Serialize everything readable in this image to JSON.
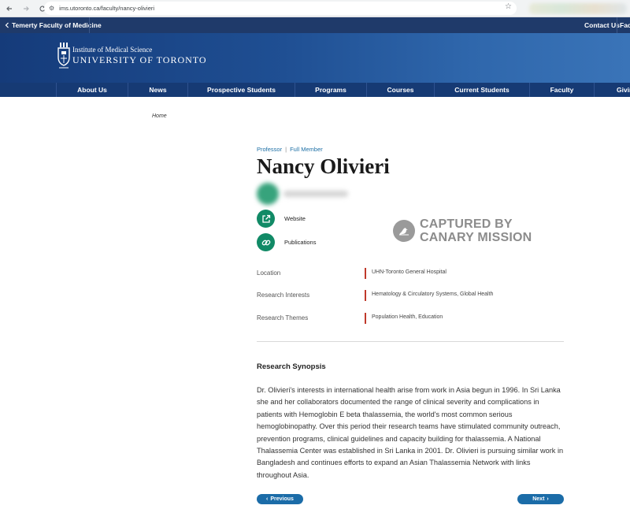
{
  "browser": {
    "url": "ims.utoronto.ca/faculty/nancy-olivieri"
  },
  "faculty_bar": {
    "back_link": "Temerty Faculty of Medicine",
    "contact": "Contact Us",
    "faculty_truncated": "Facu"
  },
  "banner": {
    "institute": "Institute of Medical Science",
    "university": "UNIVERSITY OF TORONTO"
  },
  "nav": {
    "items": [
      "About Us",
      "News",
      "Prospective Students",
      "Programs",
      "Courses",
      "Current Students",
      "Faculty",
      "Givin"
    ]
  },
  "breadcrumb": "Home",
  "profile": {
    "role_primary": "Professor",
    "role_secondary": "Full Member",
    "name": "Nancy Olivieri",
    "website_label": "Website",
    "publications_label": "Publications"
  },
  "watermark": {
    "line1": "CAPTURED BY",
    "line2": "CANARY MISSION"
  },
  "info": [
    {
      "label": "Location",
      "value": "UHN-Toronto General Hospital"
    },
    {
      "label": "Research Interests",
      "value": "Hematology & Circulatory Systems, Global Health"
    },
    {
      "label": "Research Themes",
      "value": "Population Health, Education"
    }
  ],
  "synopsis": {
    "title": "Research Synopsis",
    "text": "Dr. Olivieri's interests in international health arise from work in Asia begun in 1996. In Sri Lanka she and her collaborators documented the range of clinical severity and complications in patients with Hemoglobin E beta thalassemia, the world's most common serious hemoglobinopathy. Over this period their research teams have stimulated community outreach, prevention programs, clinical guidelines and capacity building for thalassemia. A National Thalassemia Center was established in Sri Lanka in 2001. Dr. Olivieri is pursuing similar work in Bangladesh and continues efforts to expand an Asian Thalassemia Network with links throughout Asia."
  },
  "pager": {
    "previous": "Previous",
    "next": "Next"
  },
  "colors": {
    "nav_blue": "#163a74",
    "accent_green": "#118a66",
    "link_blue": "#1d6fa5",
    "divider_red": "#c0392b",
    "button_blue": "#1b6ca8"
  }
}
